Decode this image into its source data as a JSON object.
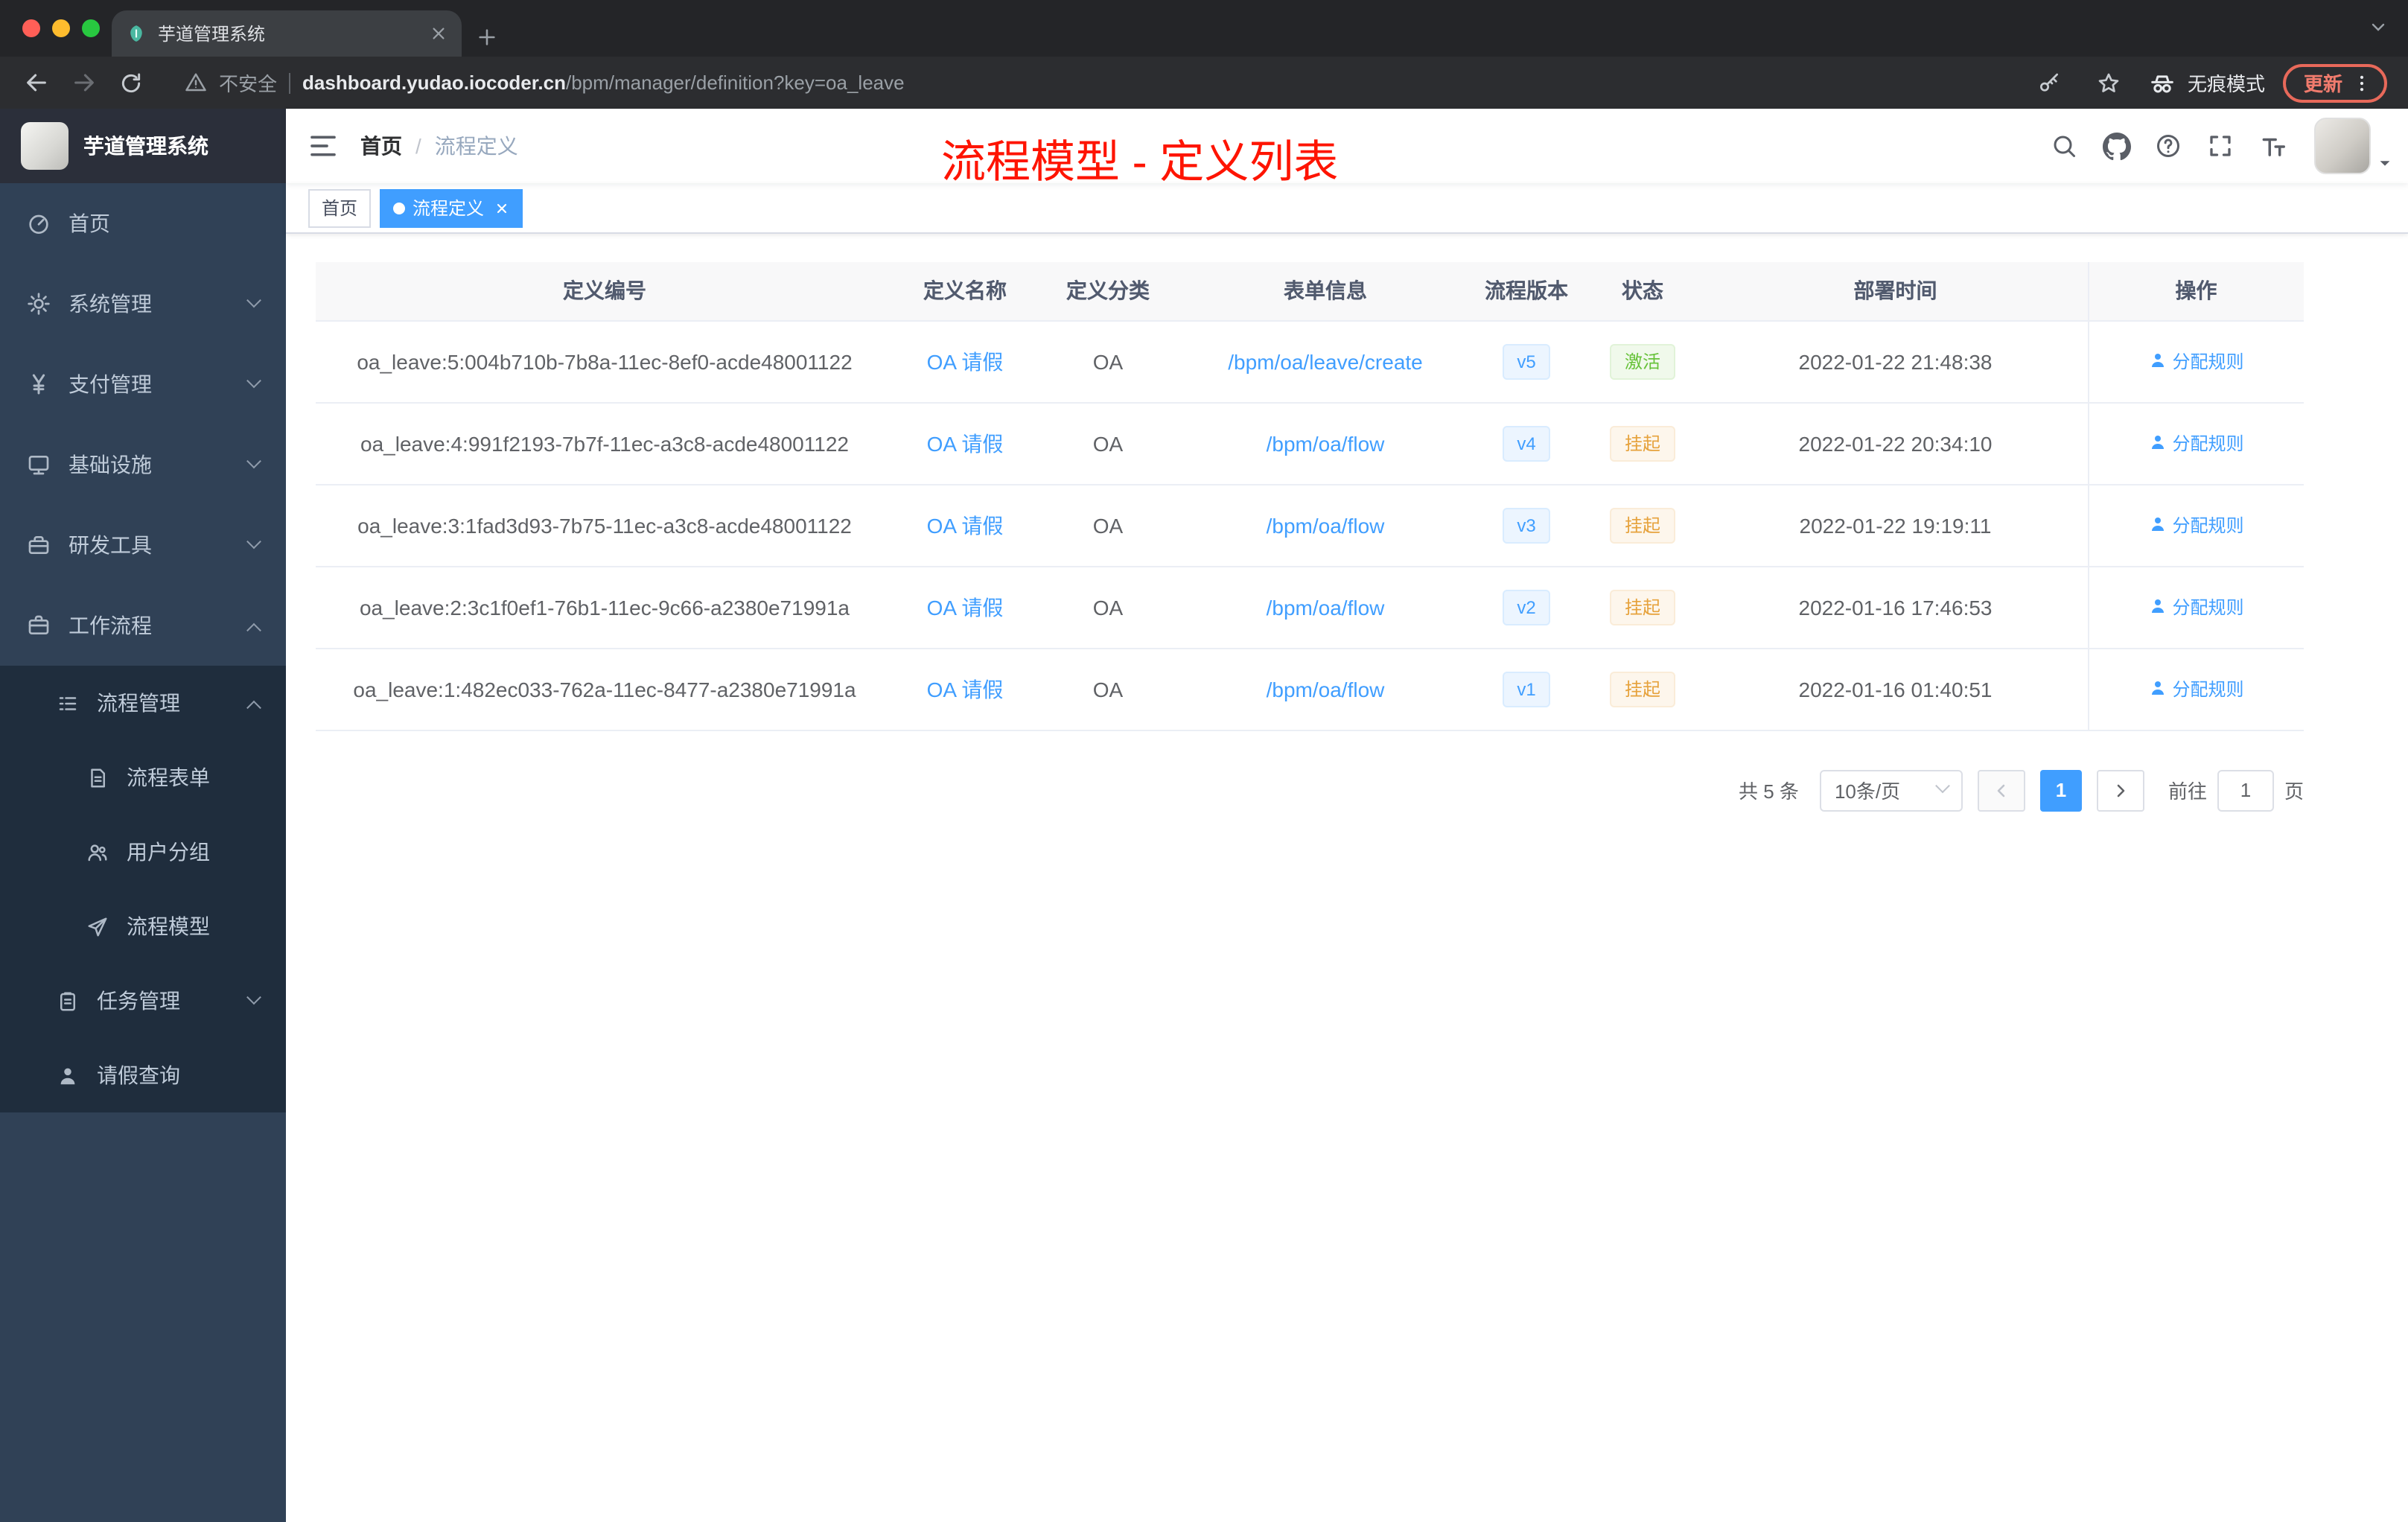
{
  "colors": {
    "accent": "#409EFF",
    "success_text": "#67c23a",
    "warning_text": "#e6a23c",
    "annotation_red": "#fe1400",
    "sidebar_bg": "#304156",
    "sidebar_submenu_bg": "#1f2d3d"
  },
  "browser": {
    "tab_title": "芋道管理系统",
    "security_label": "不安全",
    "url_host": "dashboard.yudao.iocoder.cn",
    "url_path": "/bpm/manager/definition?key=oa_leave",
    "incognito_label": "无痕模式",
    "update_label": "更新"
  },
  "sidebar": {
    "app_title": "芋道管理系统",
    "items": [
      {
        "label": "首页"
      },
      {
        "label": "系统管理"
      },
      {
        "label": "支付管理"
      },
      {
        "label": "基础设施"
      },
      {
        "label": "研发工具"
      },
      {
        "label": "工作流程",
        "children": [
          {
            "label": "流程管理",
            "children": [
              {
                "label": "流程表单"
              },
              {
                "label": "用户分组"
              },
              {
                "label": "流程模型"
              }
            ]
          },
          {
            "label": "任务管理"
          },
          {
            "label": "请假查询"
          }
        ]
      }
    ]
  },
  "header": {
    "breadcrumb": [
      "首页",
      "流程定义"
    ],
    "separator": "/",
    "annotation": "流程模型 - 定义列表"
  },
  "tags": {
    "items": [
      {
        "label": "首页",
        "active": false
      },
      {
        "label": "流程定义",
        "active": true
      }
    ]
  },
  "table": {
    "columns": [
      "定义编号",
      "定义名称",
      "定义分类",
      "表单信息",
      "流程版本",
      "状态",
      "部署时间",
      "操作"
    ],
    "rows": [
      {
        "id": "oa_leave:5:004b710b-7b8a-11ec-8ef0-acde48001122",
        "name": "OA 请假",
        "category": "OA",
        "form": "/bpm/oa/leave/create",
        "version": "v5",
        "status": "激活",
        "status_type": "success",
        "deploy_time": "2022-01-22 21:48:38",
        "action": "分配规则"
      },
      {
        "id": "oa_leave:4:991f2193-7b7f-11ec-a3c8-acde48001122",
        "name": "OA 请假",
        "category": "OA",
        "form": "/bpm/oa/flow",
        "version": "v4",
        "status": "挂起",
        "status_type": "warning",
        "deploy_time": "2022-01-22 20:34:10",
        "action": "分配规则"
      },
      {
        "id": "oa_leave:3:1fad3d93-7b75-11ec-a3c8-acde48001122",
        "name": "OA 请假",
        "category": "OA",
        "form": "/bpm/oa/flow",
        "version": "v3",
        "status": "挂起",
        "status_type": "warning",
        "deploy_time": "2022-01-22 19:19:11",
        "action": "分配规则"
      },
      {
        "id": "oa_leave:2:3c1f0ef1-76b1-11ec-9c66-a2380e71991a",
        "name": "OA 请假",
        "category": "OA",
        "form": "/bpm/oa/flow",
        "version": "v2",
        "status": "挂起",
        "status_type": "warning",
        "deploy_time": "2022-01-16 17:46:53",
        "action": "分配规则"
      },
      {
        "id": "oa_leave:1:482ec033-762a-11ec-8477-a2380e71991a",
        "name": "OA 请假",
        "category": "OA",
        "form": "/bpm/oa/flow",
        "version": "v1",
        "status": "挂起",
        "status_type": "warning",
        "deploy_time": "2022-01-16 01:40:51",
        "action": "分配规则"
      }
    ]
  },
  "pagination": {
    "total": "共 5 条",
    "page_size": "10条/页",
    "current_page": "1",
    "goto_label": "前往",
    "goto_value": "1",
    "unit_label": "页"
  }
}
